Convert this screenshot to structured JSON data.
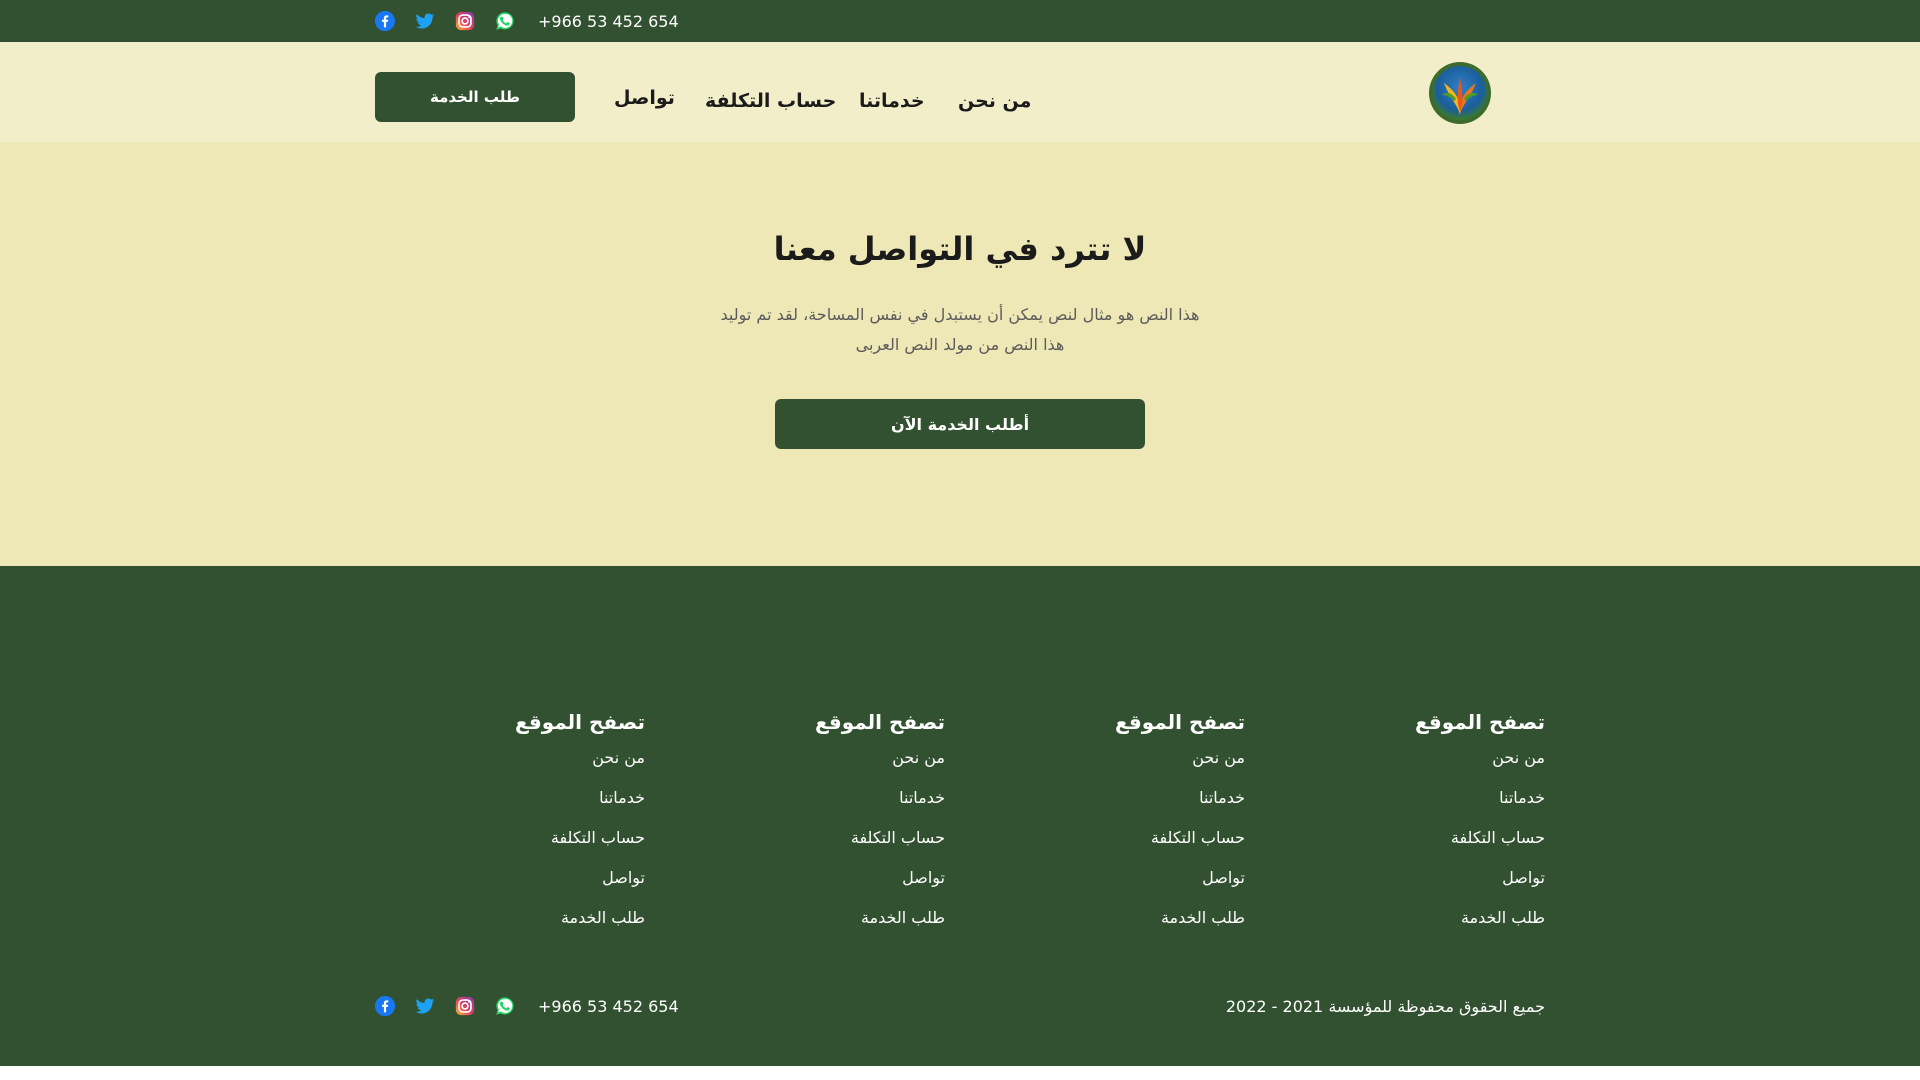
{
  "topbar": {
    "phone": "+966 53 452 654",
    "social": [
      "facebook-icon",
      "twitter-icon",
      "instagram-icon",
      "whatsapp-icon"
    ]
  },
  "header": {
    "nav": [
      "من نحن",
      "خدماتنا",
      "حساب التكلفة",
      "تواصل"
    ],
    "cta_label": "طلب الخدمة"
  },
  "hero": {
    "title": "لا تترد في التواصل معنا",
    "text_line1": "هذا النص هو مثال لنص يمكن أن يستبدل في نفس المساحة، لقد تم توليد",
    "text_line2": "هذا النص من مولد النص العربى",
    "cta_label": "أطلب الخدمة الآن"
  },
  "footer": {
    "columns": [
      {
        "title": "تصفح الموقع",
        "links": [
          "من نحن",
          "خدماتنا",
          "حساب التكلفة",
          "تواصل",
          "طلب الخدمة"
        ]
      },
      {
        "title": "تصفح الموقع",
        "links": [
          "من نحن",
          "خدماتنا",
          "حساب التكلفة",
          "تواصل",
          "طلب الخدمة"
        ]
      },
      {
        "title": "تصفح الموقع",
        "links": [
          "من نحن",
          "خدماتنا",
          "حساب التكلفة",
          "تواصل",
          "طلب الخدمة"
        ]
      },
      {
        "title": "تصفح الموقع",
        "links": [
          "من نحن",
          "خدماتنا",
          "حساب التكلفة",
          "تواصل",
          "طلب الخدمة"
        ]
      }
    ],
    "copyright": "جميع الحقوق محفوظة للمؤسسة 2021 - 2022",
    "phone": "+966 53 452 654"
  },
  "colors": {
    "brand_dark_green": "#325130",
    "header_bg": "#f2eeca",
    "hero_bg": "#ede8b6",
    "facebook": "#1877f2",
    "twitter": "#1da1f2",
    "whatsapp": "#25d366"
  }
}
